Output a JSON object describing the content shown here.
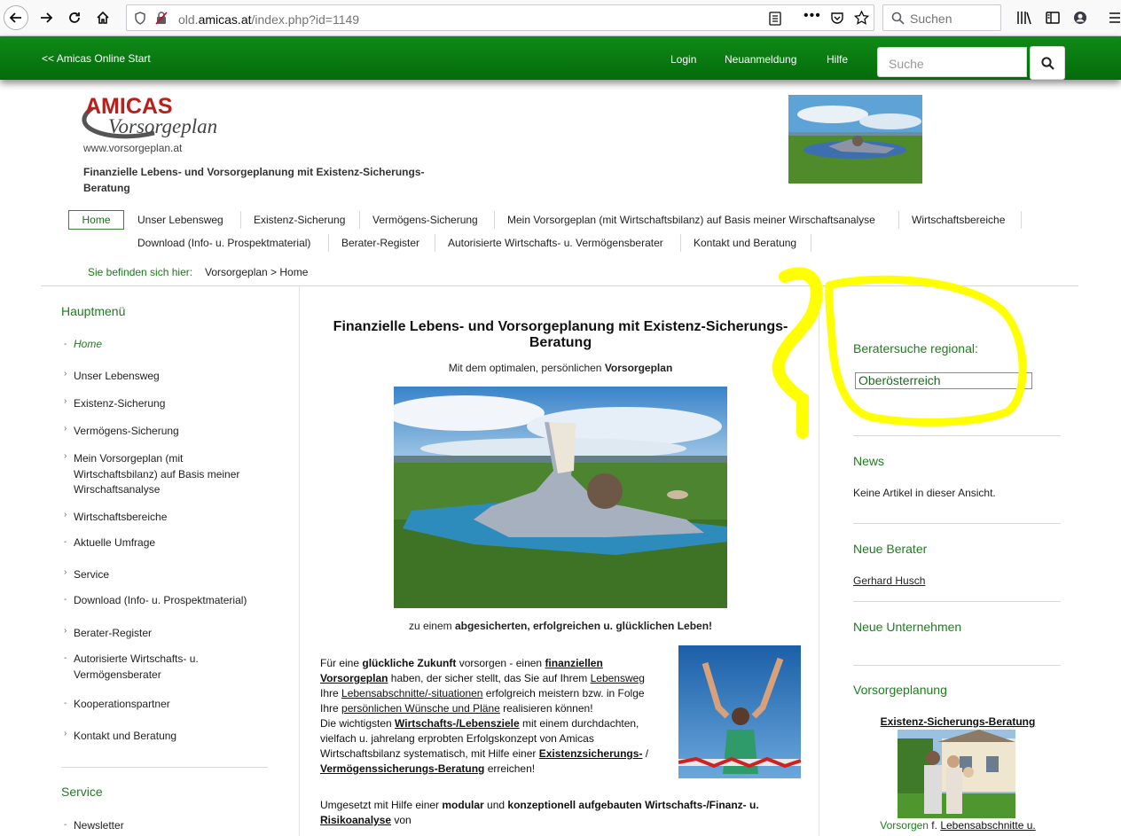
{
  "browser": {
    "url_prefix": "old.",
    "url_domain": "amicas.at",
    "url_path": "/index.php?id=1149",
    "search_placeholder": "Suchen"
  },
  "topbar": {
    "start_link": "<< Amicas Online Start",
    "nav": [
      "Login",
      "Neuanmeldung",
      "Hilfe"
    ],
    "search_placeholder": "Suche"
  },
  "header": {
    "logo_line1": "AMICAS",
    "logo_line2": "Vorsorgeplan",
    "website": "www.vorsorgeplan.at",
    "tagline": "Finanzielle Lebens- und Vorsorgeplanung mit Existenz-Sicherungs-Beratung"
  },
  "main_nav": {
    "row1": [
      "Home",
      "Unser Lebensweg",
      "Existenz-Sicherung",
      "Vermögens-Sicherung",
      "Mein Vorsorgeplan (mit Wirtschaftsbilanz) auf Basis meiner Wirschaftsanalyse",
      "Wirtschaftsbereiche"
    ],
    "row2": [
      "Download (Info- u. Prospektmaterial)",
      "Berater-Register",
      "Autorisierte Wirtschafts- u. Vermögensberater",
      "Kontakt und Beratung"
    ]
  },
  "breadcrumb": {
    "label": "Sie befinden sich hier:",
    "path": "Vorsorgeplan > Home"
  },
  "sidebar": {
    "title": "Hauptmenü",
    "items": [
      "Home",
      "Unser Lebensweg",
      "Existenz-Sicherung",
      "Vermögens-Sicherung",
      "Mein Vorsorgeplan (mit Wirtschaftsbilanz) auf Basis meiner Wirschaftsanalyse",
      "Wirtschaftsbereiche",
      "Aktuelle Umfrage",
      "Service",
      "Download (Info- u. Prospektmaterial)",
      "Berater-Register",
      "Autorisierte Wirtschafts- u. Vermögensberater",
      "Kooperationspartner",
      "Kontakt und Beratung"
    ],
    "service_title": "Service",
    "service_items": [
      "Newsletter"
    ]
  },
  "content": {
    "title": "Finanzielle Lebens- und Vorsorgeplanung mit Existenz-Sicherungs-Beratung",
    "subtitle_prefix": "Mit dem optimalen, persönlichen ",
    "subtitle_bold": "Vorsorgeplan",
    "caption_prefix": "zu einem ",
    "caption_bold": "abgesicherten, erfolgreichen u. glücklichen Leben!",
    "p1": {
      "t1": "Für eine ",
      "b1": "glückliche Zukunft",
      "t2": " vorsorgen - einen ",
      "l1": "finanziellen Vorsorgeplan",
      "t3": " haben, der sicher stellt, das Sie auf Ihrem ",
      "l2": "Lebensweg",
      "t4": " Ihre ",
      "l3": "Lebensabschnitte/-situationen",
      "t5": " erfolgreich meistern bzw. in Folge Ihre ",
      "l4": "persönlichen Wünsche und Pläne",
      "t6": " realisieren können!",
      "t7": "Die wichtigsten ",
      "l5": "Wirtschafts-/Lebensziele",
      "t8": " mit einem durchdachten, vielfach u. jahrelang erprobten Erfolgskonzept von Amicas Wirtschaftsbilanz systematisch, mit Hilfe einer ",
      "l6": "Existenzsicherungs-",
      "t9": " / ",
      "l7": "Vermögenssicherungs-Beratung",
      "t10": " erreichen!"
    },
    "p2": {
      "t1": "Umgesetzt mit Hilfe einer ",
      "b1": "modular",
      "t2": " und ",
      "b2": "konzeptionell aufgebauten Wirtschafts-/Finanz- u. ",
      "l1": "Risikoanalyse",
      "t3": " von"
    }
  },
  "right": {
    "search_title": "Beratersuche regional:",
    "region_selected": "Oberösterreich",
    "news_title": "News",
    "news_text": "Keine Artikel in dieser Ansicht.",
    "advisors_title": "Neue Berater",
    "advisor_name": "Gerhard Husch",
    "companies_title": "Neue Unternehmen",
    "planning_title": "Vorsorgeplanung",
    "planning_link": "Existenz-Sicherungs-Beratung",
    "planning_cap_green": "Vorsorgen",
    "planning_cap_mid": " f. ",
    "planning_cap_link": "Lebensabschnitte u."
  },
  "colors": {
    "topbar_green": "#0a7d12",
    "accent_green": "#1e7d1e",
    "annotation_yellow": "#ffff00"
  }
}
